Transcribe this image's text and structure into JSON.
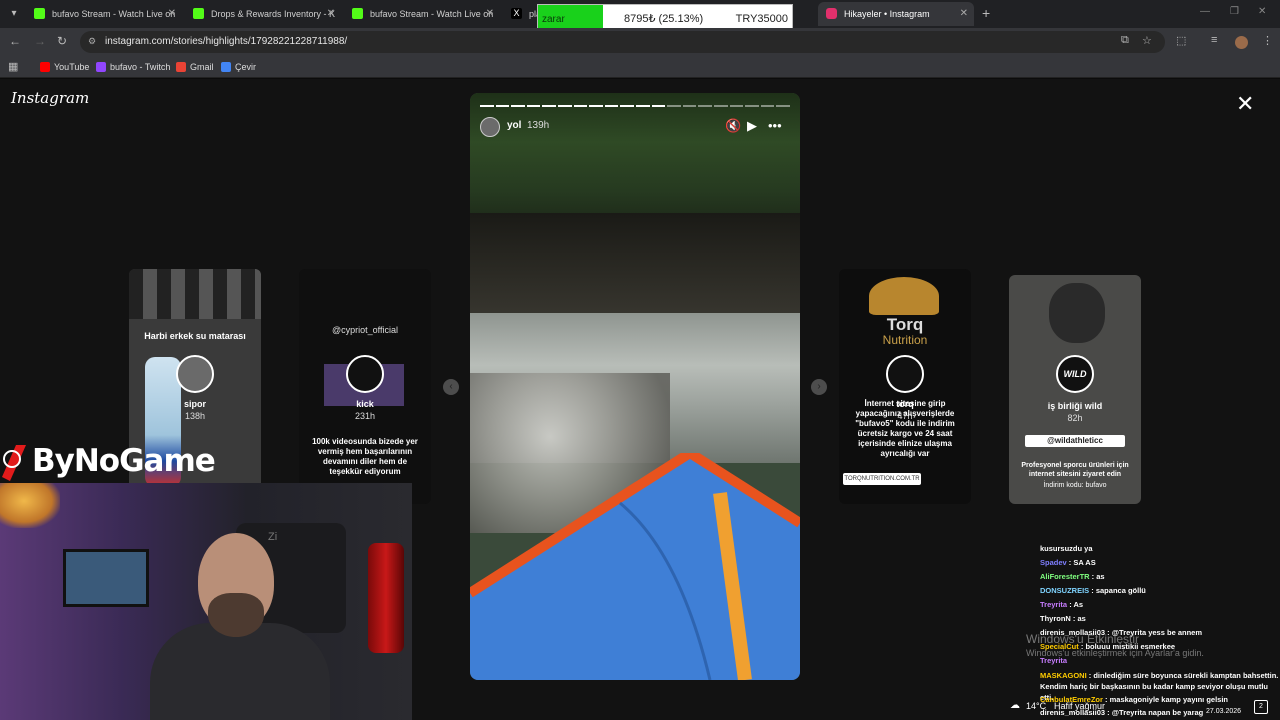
{
  "browser": {
    "tabs": [
      {
        "title": "bufavo Stream - Watch Live on",
        "fav_color": "#53fc18"
      },
      {
        "title": "Drops & Rewards Inventory - K",
        "fav_color": "#53fc18"
      },
      {
        "title": "bufavo Stream - Watch Live on",
        "fav_color": "#53fc18"
      },
      {
        "title": "plat",
        "fav_color": "#000000"
      },
      {
        "title": "Hikayeler • Instagram",
        "fav_color": "#e1306c"
      }
    ],
    "url": "instagram.com/stories/highlights/17928221228711988/",
    "bookmarks": [
      {
        "label": "YouTube",
        "color": "#ff0000"
      },
      {
        "label": "bufavo - Twitch",
        "color": "#9146ff"
      },
      {
        "label": "Gmail",
        "color": "#ea4335"
      },
      {
        "label": "Çevir",
        "color": "#4285f4"
      }
    ]
  },
  "overlay": {
    "status": "zarar",
    "value": "8795₺ (25.13%)",
    "goal": "TRY35000",
    "accent": "#19d11b"
  },
  "instagram": {
    "logo": "Instagram",
    "close_icon": "close-icon",
    "story": {
      "user": "yol",
      "time": "139h",
      "segments_total": 20,
      "segments_done": 12
    },
    "side_stories": [
      {
        "caption": "Harbi erkek su matarası",
        "name": "sipor",
        "time": "138h"
      },
      {
        "caption": "@cypriot_official",
        "name": "kick",
        "time": "231h",
        "text": "100k videosunda bizede yer vermiş hem başarılarının devamını diler hem de teşekkür ediyorum"
      },
      {
        "brand": "Torq",
        "brand2": "Nutrition",
        "name": "torq",
        "time": "47h",
        "text": "İnternet sitesine girip yapacağınız alışverişlerde \"bufavo5\" kodu ile indirim ücretsiz kargo ve 24 saat içerisinde elinize ulaşma ayrıcalığı var",
        "link": "TORQNUTRITION.COM.TR"
      },
      {
        "caption": "iş birliği wild",
        "time": "82h",
        "handle": "@wildathleticc",
        "text": "Profesyonel sporcu ürünleri için internet sitesini ziyaret edin",
        "code": "İndirim kodu: bufavo"
      }
    ]
  },
  "stream": {
    "brand": "ByNoGame",
    "chair_text": "Zi"
  },
  "chat": [
    {
      "user": "",
      "msg": "kusursuzdu ya",
      "color": "#ffffff"
    },
    {
      "user": "Spadev",
      "msg": "SA AS",
      "color": "#7f7fff"
    },
    {
      "user": "AliForesterTR",
      "msg": "as",
      "color": "#7fff7f"
    },
    {
      "user": "DONSUZREIS",
      "msg": "sapanca göllü",
      "color": "#7fd4ff"
    },
    {
      "user": "Treyrita",
      "msg": "As",
      "color": "#c77dff"
    },
    {
      "user": "ThyronN",
      "msg": "as",
      "color": "#ffffff"
    },
    {
      "user": "direnis_mollasii03",
      "msg": "@Treyrita yess be annem",
      "color": "#ffffff"
    },
    {
      "user": "SpecialCut",
      "msg": "boluuu mistikii esmerkee",
      "color": "#ffcc00"
    },
    {
      "user": "Treyrita",
      "msg": "",
      "color": "#c77dff"
    },
    {
      "user": "MASKAGONI",
      "msg": "dinlediğim süre boyunca sürekli kamptan bahsettin. Kendim hariç bir başkasının bu kadar kamp seviyor oluşu mutlu etti.",
      "color": "#ffcc00"
    },
    {
      "user": "CanbulatEmreZor",
      "msg": "maskagoniyle kamp yayını gelsin",
      "color": "#ffcc00"
    },
    {
      "user": "direnis_mollasii03",
      "msg": "@Treyrita napan be yarag",
      "color": "#ffffff"
    }
  ],
  "watermark": {
    "line1": "Windows'u Etkinleştir",
    "line2": "Windows'u etkinleştirmek için Ayarlar'a gidin."
  },
  "taskbar": {
    "temp": "14°C",
    "weather": "Hafif yağmur",
    "date": "27.03.2026",
    "notifications": "2"
  }
}
